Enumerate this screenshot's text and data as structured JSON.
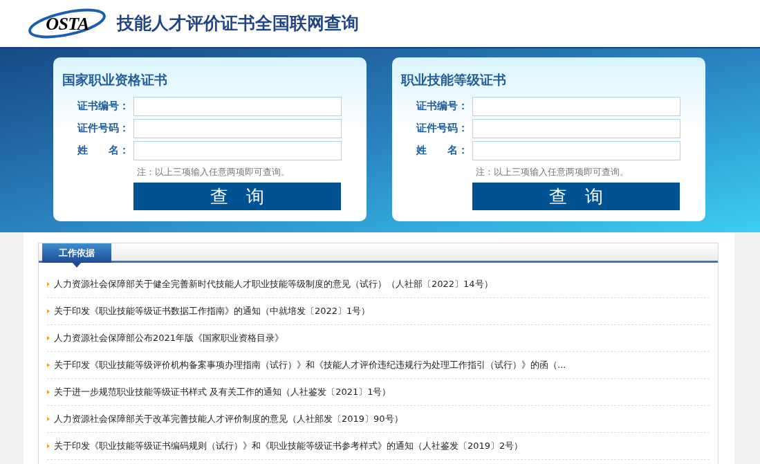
{
  "header": {
    "logo": "OSTA",
    "title": "技能人才评价证书全国联网查询"
  },
  "query_cards": [
    {
      "title": "国家职业资格证书",
      "fields": [
        {
          "label": "证书编号："
        },
        {
          "label": "证件号码："
        },
        {
          "label": "姓　　名："
        }
      ],
      "note": "注：以上三项输入任意两项即可查询。",
      "button": "查　询"
    },
    {
      "title": "职业技能等级证书",
      "fields": [
        {
          "label": "证书编号："
        },
        {
          "label": "证件号码："
        },
        {
          "label": "姓　　名："
        }
      ],
      "note": "注：以上三项输入任意两项即可查询。",
      "button": "查　询"
    }
  ],
  "section": {
    "tab": "工作依据",
    "items": [
      "人力资源社会保障部关于健全完善新时代技能人才职业技能等级制度的意见（试行）（人社部〔2022〕14号）",
      "关于印发《职业技能等级证书数据工作指南》的通知（中就培发〔2022〕1号）",
      "人力资源社会保障部公布2021年版《国家职业资格目录》",
      "关于印发《职业技能等级评价机构备案事项办理指南（试行）》和《技能人才评价违纪违规行为处理工作指引（试行）》的函（...",
      "关于进一步规范职业技能等级证书样式 及有关工作的通知（人社鉴发〔2021〕1号）",
      "人力资源社会保障部关于改革完善技能人才评价制度的意见（人社部发〔2019〕90号）",
      "关于印发《职业技能等级证书编码规则（试行）》和《职业技能等级证书参考样式》的通知（人社鉴发〔2019〕2号）"
    ]
  }
}
